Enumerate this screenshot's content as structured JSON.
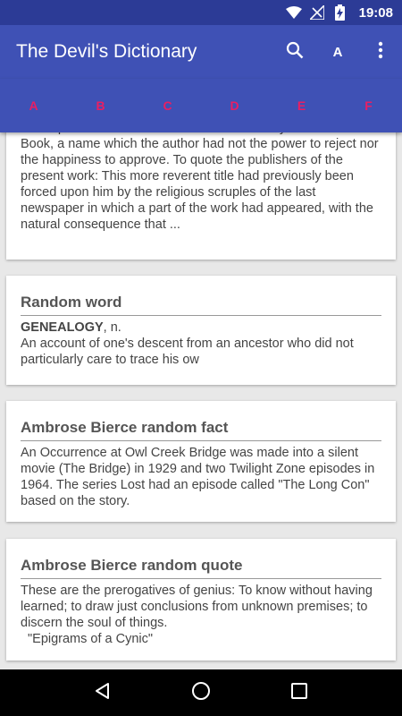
{
  "status_bar": {
    "time": "19:08",
    "icons": [
      "wifi-icon",
      "signal-icon",
      "battery-charging-icon"
    ]
  },
  "app_bar": {
    "title": "The Devil's Dictionary",
    "search_icon": "search-icon",
    "font_label": "A",
    "menu_icon": "more-vert-icon"
  },
  "tabs": [
    "A",
    "B",
    "C",
    "D",
    "E",
    "F"
  ],
  "colors": {
    "primary": "#3f51b5",
    "primary_dark": "#2c3b96",
    "accent": "#e91e63"
  },
  "cards": {
    "intro": {
      "text": "It was published in covers with the title The Cynic's Word Book, a name which the author had not the power to reject nor the happiness to approve. To quote the publishers of the present work: This more reverent title had previously been forced upon him by the religious scruples of the last newspaper in which a part of the work had appeared, with the natural consequence that ..."
    },
    "random_word": {
      "title": "Random word",
      "word": "GENEALOGY",
      "pos": ", n.",
      "definition": "An account of one's descent from an ancestor who did not particularly care to trace his ow"
    },
    "random_fact": {
      "title": "Ambrose Bierce random fact",
      "text": "An Occurrence at Owl Creek Bridge was made into a silent movie (The Bridge) in 1929 and two Twilight Zone episodes in 1964. The series Lost had an episode called \"The Long Con\" based on the story."
    },
    "random_quote": {
      "title": "Ambrose Bierce random quote",
      "text": "These are the prerogatives of genius: To know without having learned; to draw just conclusions from unknown premises; to discern the soul of things.",
      "source": "\"Epigrams of a Cynic\""
    }
  },
  "nav_bar": {
    "back": "back-icon",
    "home": "home-icon",
    "recents": "recents-icon"
  }
}
